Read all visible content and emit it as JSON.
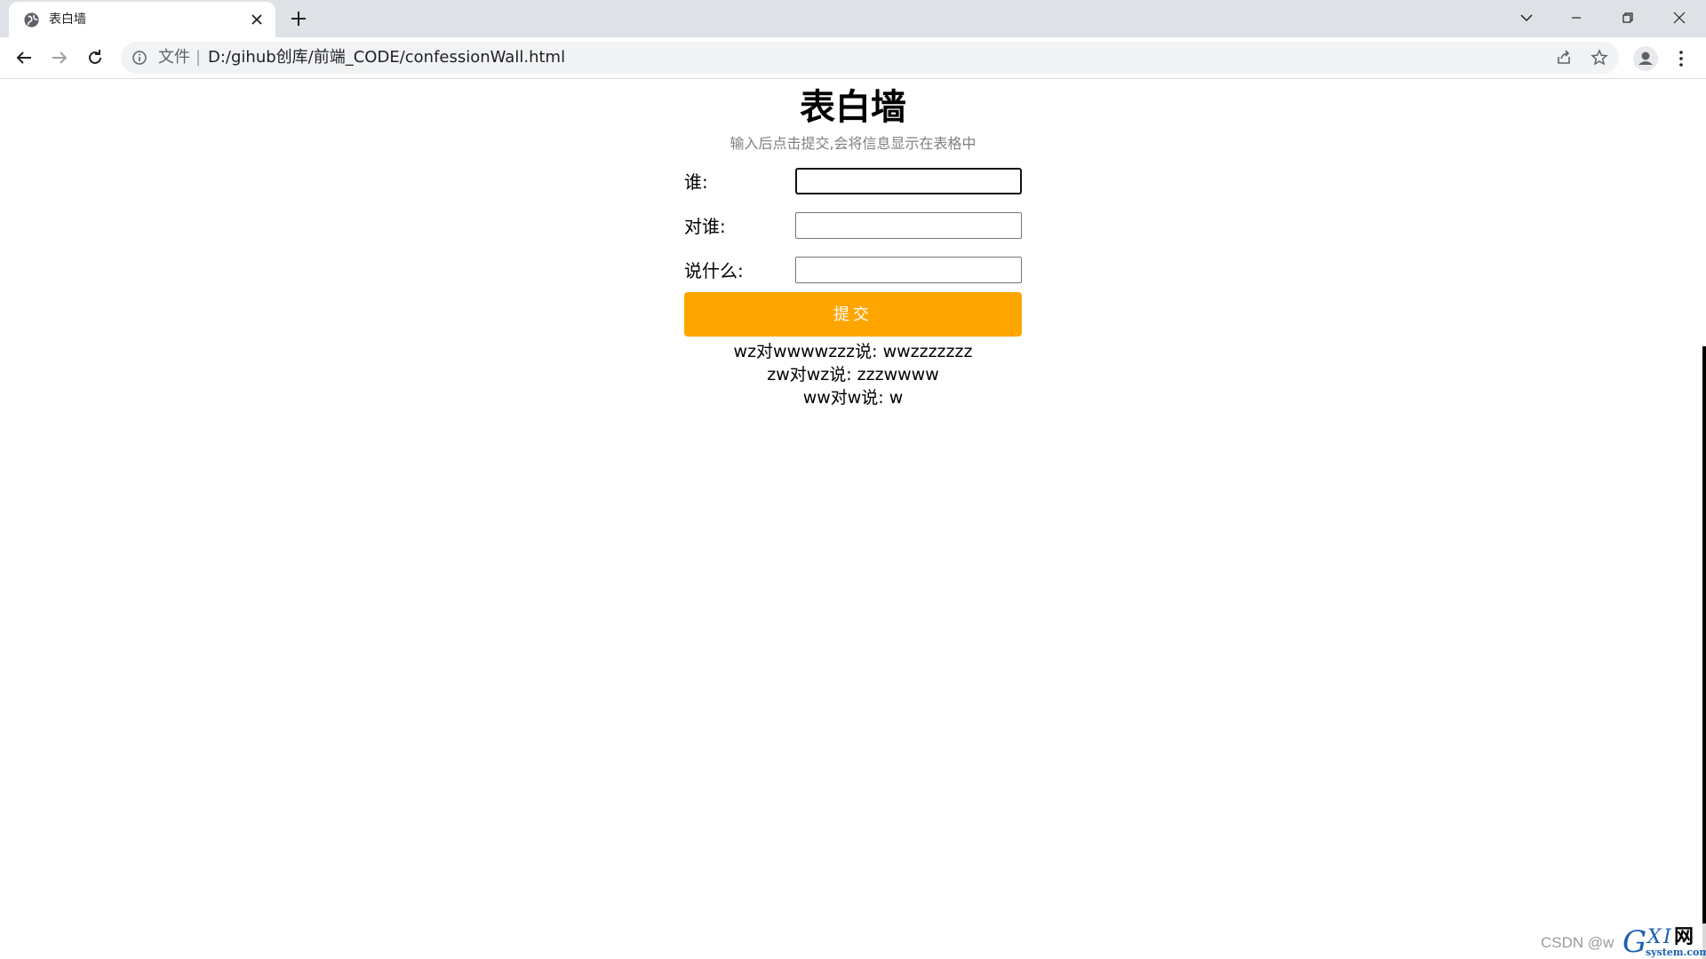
{
  "browser": {
    "tab": {
      "title": "表白墙",
      "favicon": "globe-icon",
      "close_icon": "close-icon"
    },
    "new_tab_icon": "plus-icon",
    "window_controls": [
      "chevron-down-icon",
      "minimize-icon",
      "restore-icon",
      "close-icon"
    ],
    "toolbar": {
      "back_icon": "back-arrow-icon",
      "forward_icon": "forward-arrow-icon",
      "reload_icon": "reload-icon",
      "scheme_label": "文件",
      "separator": "|",
      "url": "D:/gihub创库/前端_CODE/confessionWall.html",
      "share_icon": "share-icon",
      "bookmark_icon": "star-icon",
      "profile_icon": "profile-icon",
      "menu_icon": "kebab-menu-icon"
    }
  },
  "page": {
    "title": "表白墙",
    "subtitle": "输入后点击提交,会将信息显示在表格中",
    "form": {
      "fields": [
        {
          "label": "谁:",
          "value": ""
        },
        {
          "label": "对谁:",
          "value": ""
        },
        {
          "label": "说什么:",
          "value": ""
        }
      ],
      "submit_label": "提交"
    },
    "messages": [
      "wz对wwwwzzz说: wwzzzzzzz",
      "zw对wz说: zzzwwww",
      "ww对w说: w"
    ]
  },
  "watermark": {
    "csdn_text": "CSDN @w",
    "logo_letters": "GXI",
    "logo_cn": "网",
    "logo_domain": "system.com"
  },
  "colors": {
    "submit_button": "#ffa500",
    "subtitle": "#808080",
    "tabstrip": "#dee1e6",
    "omnibox": "#f1f3f4"
  }
}
